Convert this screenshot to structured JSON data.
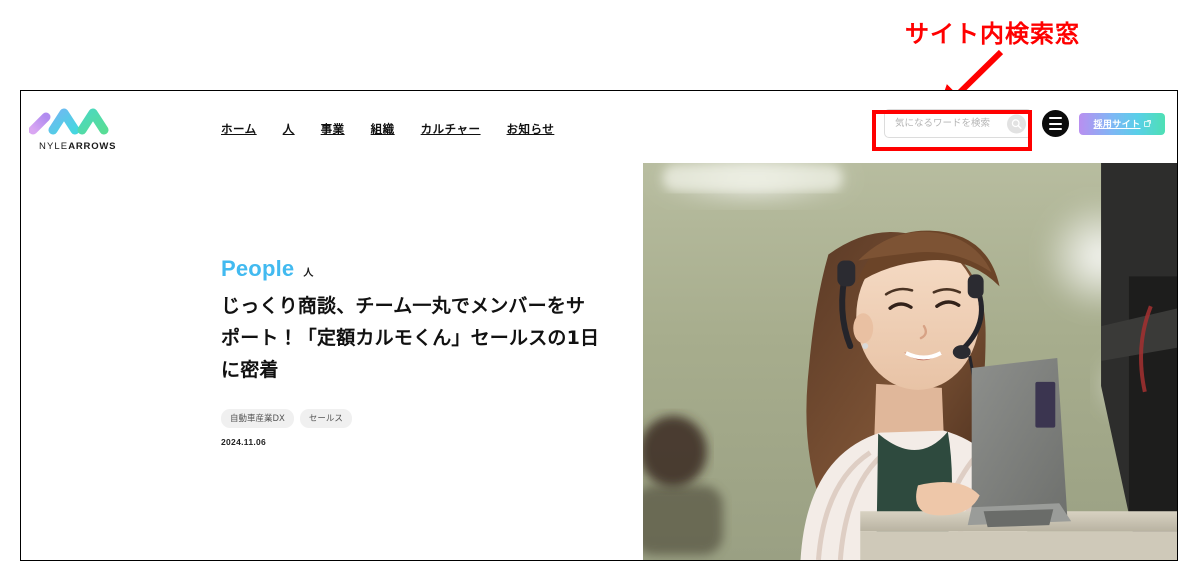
{
  "annotation": {
    "label": "サイト内検索窓",
    "color": "#ff0000",
    "arrow_name": "red-arrow-pointing-to-search",
    "highlight_target": "site-search-box"
  },
  "header": {
    "logo": {
      "name": "nyle-arrows-logo",
      "wordmark_light": "NYLE",
      "wordmark_bold": "ARROWS",
      "colors": [
        "#c89ef0",
        "#6fb9f2",
        "#4dd9e0",
        "#54dba6"
      ]
    },
    "nav": [
      {
        "label": "ホーム",
        "name": "nav-home"
      },
      {
        "label": "人",
        "name": "nav-people"
      },
      {
        "label": "事業",
        "name": "nav-business"
      },
      {
        "label": "組織",
        "name": "nav-organization"
      },
      {
        "label": "カルチャー",
        "name": "nav-culture"
      },
      {
        "label": "お知らせ",
        "name": "nav-news"
      }
    ],
    "search": {
      "placeholder": "気になるワードを検索",
      "value": "",
      "submit_icon": "search-icon"
    },
    "menu_toggle_icon": "hamburger-menu-icon",
    "recruit_button": {
      "label": "採用サイト",
      "external_icon": "external-link-icon",
      "gradient_from": "#b98ff0",
      "gradient_to": "#4ee0b4"
    }
  },
  "hero": {
    "category_en": "People",
    "category_ja": "人",
    "category_color": "#42baf0",
    "title": "じっくり商談、チーム一丸でメンバーをサポート！「定額カルモくん」セールスの1日に密着",
    "tags": [
      "自動車産業DX",
      "セールス"
    ],
    "date": "2024.11.06",
    "photo_alt": "ヘッドセットを着けて笑顔で働く女性社員のオフィス写真"
  }
}
